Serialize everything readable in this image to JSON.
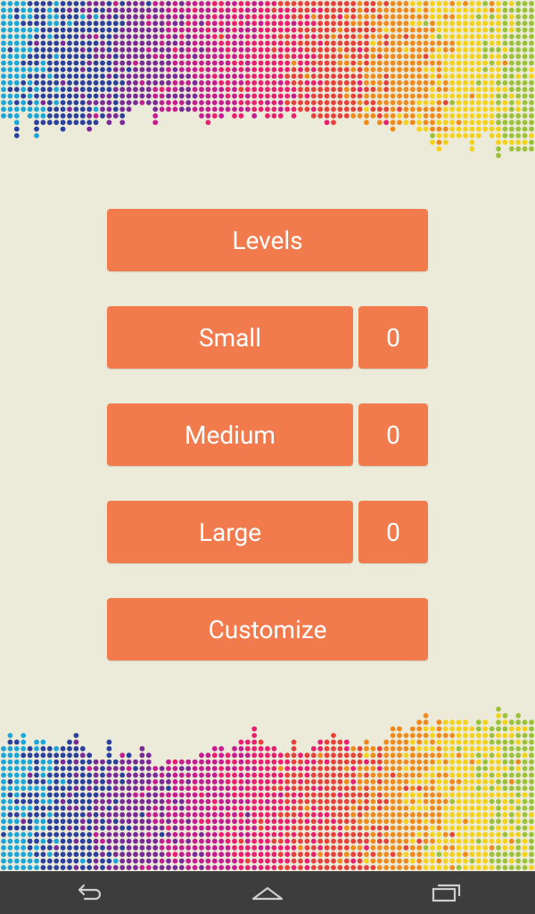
{
  "colors": {
    "background": "#ecebda",
    "button": "#f27b4d",
    "button_text": "#ffffff",
    "navbar": "#3d3d3d",
    "dot_palette": [
      "#1aa6d9",
      "#2b3f9c",
      "#7a2a96",
      "#c41d8f",
      "#ea1f6f",
      "#e8403a",
      "#f08a1c",
      "#f5d21a",
      "#9cc23b"
    ]
  },
  "menu": {
    "levels_label": "Levels",
    "modes": [
      {
        "label": "Small",
        "count": "0"
      },
      {
        "label": "Medium",
        "count": "0"
      },
      {
        "label": "Large",
        "count": "0"
      }
    ],
    "customize_label": "Customize"
  },
  "navbar": {
    "icons": [
      "back-icon",
      "home-icon",
      "recent-apps-icon"
    ]
  }
}
